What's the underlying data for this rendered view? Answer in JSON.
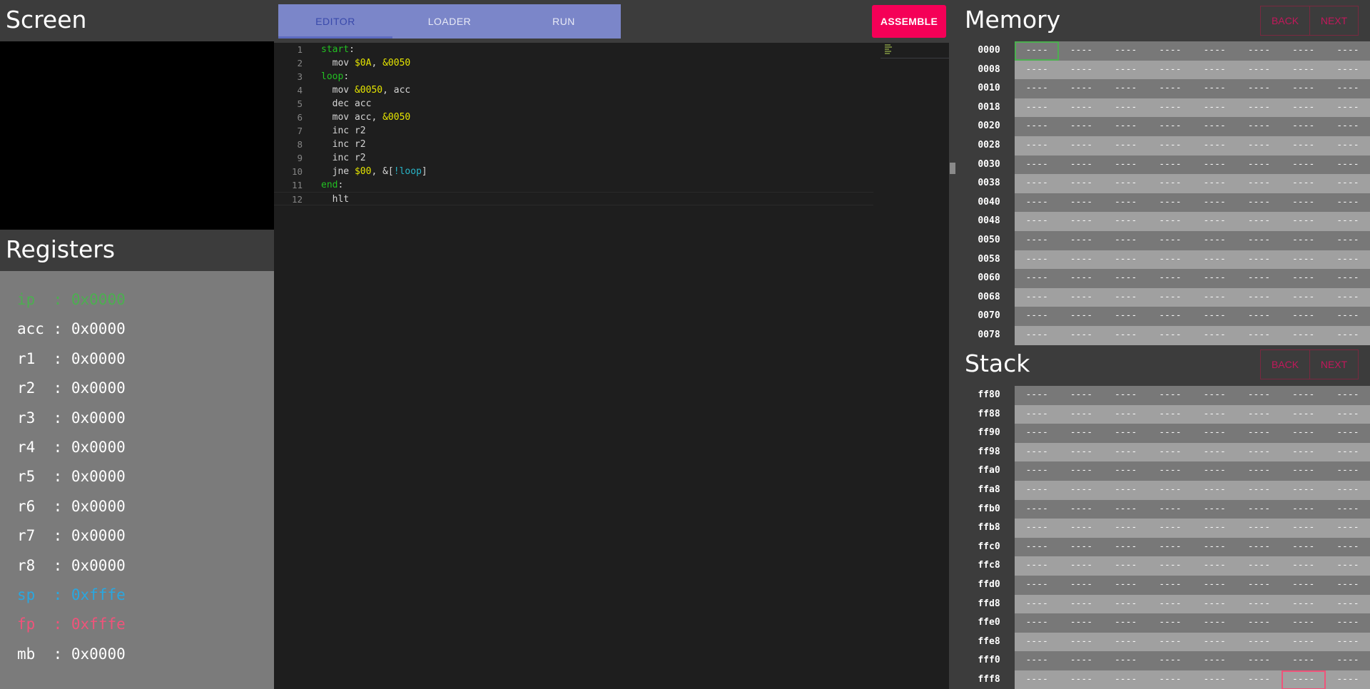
{
  "screen": {
    "title": "Screen"
  },
  "registers": {
    "title": "Registers",
    "items": [
      {
        "name": "ip ",
        "value": "0x0000"
      },
      {
        "name": "acc",
        "value": "0x0000"
      },
      {
        "name": "r1 ",
        "value": "0x0000"
      },
      {
        "name": "r2 ",
        "value": "0x0000"
      },
      {
        "name": "r3 ",
        "value": "0x0000"
      },
      {
        "name": "r4 ",
        "value": "0x0000"
      },
      {
        "name": "r5 ",
        "value": "0x0000"
      },
      {
        "name": "r6 ",
        "value": "0x0000"
      },
      {
        "name": "r7 ",
        "value": "0x0000"
      },
      {
        "name": "r8 ",
        "value": "0x0000"
      },
      {
        "name": "sp ",
        "value": "0xfffe"
      },
      {
        "name": "fp ",
        "value": "0xfffe"
      },
      {
        "name": "mb ",
        "value": "0x0000"
      }
    ],
    "colors": {
      "ip": "#4caf50",
      "sp": "#29a7e0",
      "fp": "#f0537a"
    }
  },
  "tabs": [
    {
      "label": "EDITOR",
      "active": true
    },
    {
      "label": "LOADER",
      "active": false
    },
    {
      "label": "RUN",
      "active": false
    }
  ],
  "assemble_label": "ASSEMBLE",
  "editor": {
    "lines": [
      {
        "n": "1",
        "tokens": [
          {
            "t": "start",
            "c": "lbl"
          },
          {
            "t": ":",
            "c": ""
          }
        ]
      },
      {
        "n": "2",
        "tokens": [
          {
            "t": "  mov ",
            "c": ""
          },
          {
            "t": "$0A",
            "c": "hex"
          },
          {
            "t": ", ",
            "c": ""
          },
          {
            "t": "&0050",
            "c": "hex"
          }
        ]
      },
      {
        "n": "3",
        "tokens": [
          {
            "t": "loop",
            "c": "lbl"
          },
          {
            "t": ":",
            "c": ""
          }
        ]
      },
      {
        "n": "4",
        "tokens": [
          {
            "t": "  mov ",
            "c": ""
          },
          {
            "t": "&0050",
            "c": "hex"
          },
          {
            "t": ", acc",
            "c": ""
          }
        ]
      },
      {
        "n": "5",
        "tokens": [
          {
            "t": "  dec acc",
            "c": ""
          }
        ]
      },
      {
        "n": "6",
        "tokens": [
          {
            "t": "  mov acc, ",
            "c": ""
          },
          {
            "t": "&0050",
            "c": "hex"
          }
        ]
      },
      {
        "n": "7",
        "tokens": [
          {
            "t": "  inc r2",
            "c": ""
          }
        ]
      },
      {
        "n": "8",
        "tokens": [
          {
            "t": "  inc r2",
            "c": ""
          }
        ]
      },
      {
        "n": "9",
        "tokens": [
          {
            "t": "  inc r2",
            "c": ""
          }
        ]
      },
      {
        "n": "10",
        "tokens": [
          {
            "t": "  jne ",
            "c": ""
          },
          {
            "t": "$00",
            "c": "hex"
          },
          {
            "t": ", &[",
            "c": ""
          },
          {
            "t": "!loop",
            "c": "op"
          },
          {
            "t": "]",
            "c": ""
          }
        ]
      },
      {
        "n": "11",
        "tokens": [
          {
            "t": "end",
            "c": "lbl"
          },
          {
            "t": ":",
            "c": ""
          }
        ]
      },
      {
        "n": "12",
        "tokens": [
          {
            "t": "  hlt",
            "c": ""
          }
        ]
      }
    ]
  },
  "memory": {
    "title": "Memory",
    "back_label": "BACK",
    "next_label": "NEXT",
    "addresses": [
      "0000",
      "0008",
      "0010",
      "0018",
      "0020",
      "0028",
      "0030",
      "0038",
      "0040",
      "0048",
      "0050",
      "0058",
      "0060",
      "0068",
      "0070",
      "0078"
    ],
    "cell_value": "----"
  },
  "stack": {
    "title": "Stack",
    "back_label": "BACK",
    "next_label": "NEXT",
    "addresses": [
      "ff80",
      "ff88",
      "ff90",
      "ff98",
      "ffa0",
      "ffa8",
      "ffb0",
      "ffb8",
      "ffc0",
      "ffc8",
      "ffd0",
      "ffd8",
      "ffe0",
      "ffe8",
      "fff0",
      "fff8"
    ],
    "cell_value": "----"
  }
}
